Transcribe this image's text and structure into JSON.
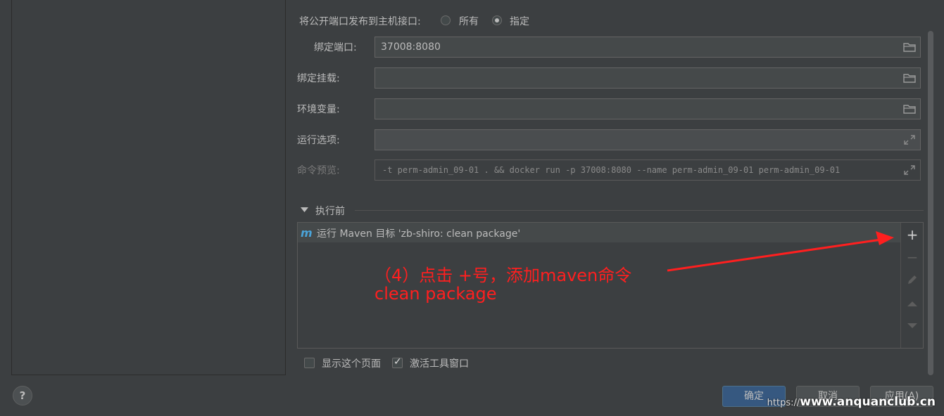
{
  "ports": {
    "publish_label": "将公开端口发布到主机接口:",
    "option_all": "所有",
    "option_specified": "指定",
    "selected": "指定"
  },
  "fields": {
    "bind_ports_label": "绑定端口:",
    "bind_ports_value": "37008:8080",
    "bind_mounts_label": "绑定挂载:",
    "bind_mounts_value": "",
    "env_vars_label": "环境变量:",
    "env_vars_value": "",
    "run_options_label": "运行选项:",
    "run_options_value": "",
    "command_preview_label": "命令预览:",
    "command_preview_value": "-t perm-admin_09-01 . && docker run -p 37008:8080 --name perm-admin_09-01 perm-admin_09-01"
  },
  "before_launch": {
    "title": "执行前",
    "tasks": [
      {
        "icon": "maven-icon",
        "label": "运行 Maven 目标 'zb-shiro: clean package'"
      }
    ],
    "toolbar": [
      "add-icon",
      "remove-icon",
      "edit-icon",
      "move-up-icon",
      "move-down-icon"
    ]
  },
  "annotation": {
    "line1": "（4）点击 +号，添加maven命令",
    "line2": "clean package",
    "color": "#ff1f1f"
  },
  "options": {
    "show_page_label": "显示这个页面",
    "show_page_checked": false,
    "activate_tool_window_label": "激活工具窗口",
    "activate_tool_window_checked": true
  },
  "buttons": {
    "ok": "确定",
    "cancel": "取消",
    "apply": "应用(A)",
    "help": "?"
  },
  "watermark": {
    "prefix": "https://",
    "site": "www.anquanclub.cn"
  },
  "colors": {
    "background": "#3c3f41",
    "primary_button": "#365880",
    "annotation": "#ff1f1f"
  }
}
